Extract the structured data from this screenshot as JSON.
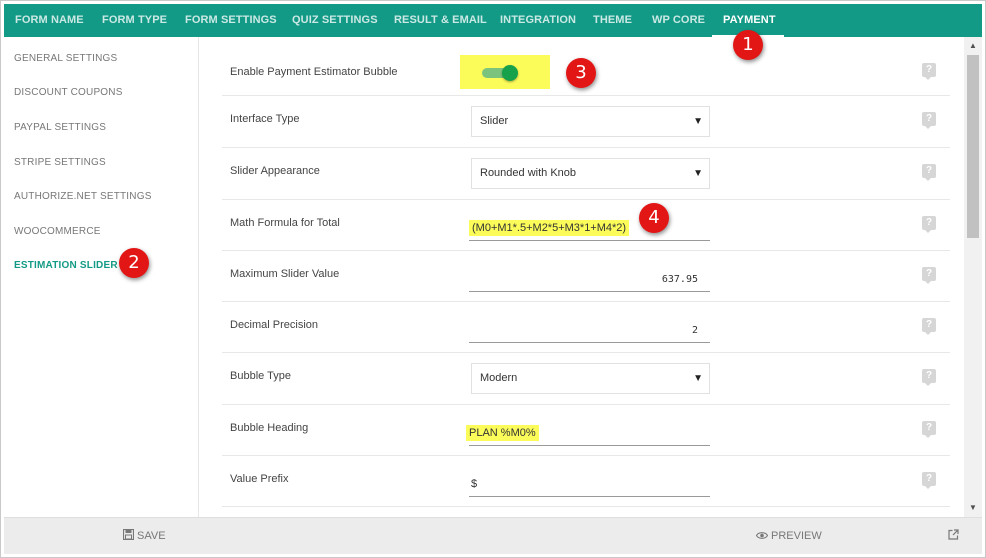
{
  "tabs": [
    {
      "label": "FORM NAME"
    },
    {
      "label": "FORM TYPE"
    },
    {
      "label": "FORM SETTINGS"
    },
    {
      "label": "QUIZ SETTINGS"
    },
    {
      "label": "RESULT & EMAIL"
    },
    {
      "label": "INTEGRATION"
    },
    {
      "label": "THEME"
    },
    {
      "label": "WP CORE"
    },
    {
      "label": "PAYMENT"
    }
  ],
  "active_tab": "PAYMENT",
  "sidebar": {
    "items": [
      {
        "label": "GENERAL SETTINGS"
      },
      {
        "label": "DISCOUNT COUPONS"
      },
      {
        "label": "PAYPAL SETTINGS"
      },
      {
        "label": "STRIPE SETTINGS"
      },
      {
        "label": "AUTHORIZE.NET SETTINGS"
      },
      {
        "label": "WOOCOMMERCE"
      },
      {
        "label": "ESTIMATION SLIDER"
      }
    ],
    "active": "ESTIMATION SLIDER"
  },
  "settings": {
    "enable_bubble": {
      "label": "Enable Payment Estimator Bubble",
      "enabled": true
    },
    "interface_type": {
      "label": "Interface Type",
      "value": "Slider"
    },
    "slider_appearance": {
      "label": "Slider Appearance",
      "value": "Rounded with Knob"
    },
    "math_formula": {
      "label": "Math Formula for Total",
      "value": "(M0+M1*.5+M2*5+M3*1+M4*2)"
    },
    "max_slider_value": {
      "label": "Maximum Slider Value",
      "value": "637.95"
    },
    "decimal_precision": {
      "label": "Decimal Precision",
      "value": "2"
    },
    "bubble_type": {
      "label": "Bubble Type",
      "value": "Modern"
    },
    "bubble_heading": {
      "label": "Bubble Heading",
      "value": "PLAN %M0%"
    },
    "value_prefix": {
      "label": "Value Prefix",
      "value": "$"
    }
  },
  "help_glyph": "?",
  "footer": {
    "save_label": "SAVE",
    "preview_label": "PREVIEW"
  },
  "markers": [
    "1",
    "2",
    "3",
    "4"
  ],
  "colors": {
    "accent": "#139a86",
    "highlight": "#fbfb5a",
    "marker": "#e31616",
    "toggle_on": "#17a14b"
  },
  "icons": {
    "save": "floppy-disk-icon",
    "preview": "eye-icon",
    "popout": "external-link-icon",
    "dropdown": "caret-down-icon",
    "help": "help-icon"
  }
}
